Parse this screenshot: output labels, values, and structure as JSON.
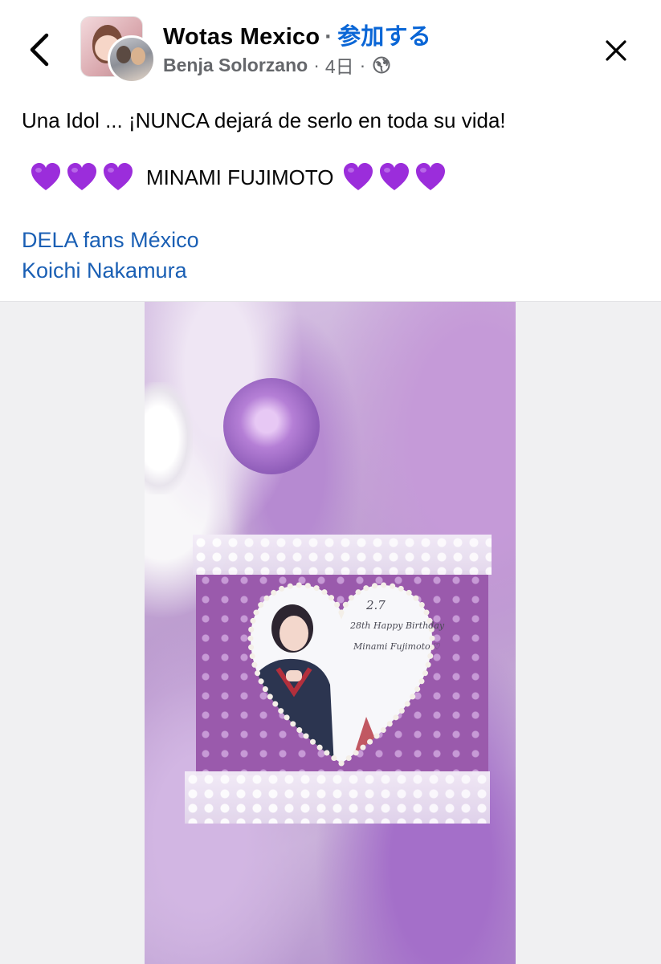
{
  "header": {
    "group_name": "Wotas Mexico",
    "separator": "·",
    "join_label": "参加する",
    "author": "Benja Solorzano",
    "time": "4日"
  },
  "post": {
    "line1": "Una Idol ... ¡NUNCA dejará  de serlo en toda su vida!",
    "name": "MINAMI FUJIMOTO",
    "heart_emoji": "purple-heart",
    "heart_color": "#9b2ddb",
    "tags": [
      "DELA fans México",
      "Koichi Nakamura"
    ]
  },
  "photo": {
    "date_text": "2.7",
    "birthday_text": "28th Happy Birthday",
    "name_text": "Minami Fujimoto ♡"
  },
  "colors": {
    "link": "#1a5fb4",
    "join": "#0a66d6",
    "meta": "#65676b"
  }
}
